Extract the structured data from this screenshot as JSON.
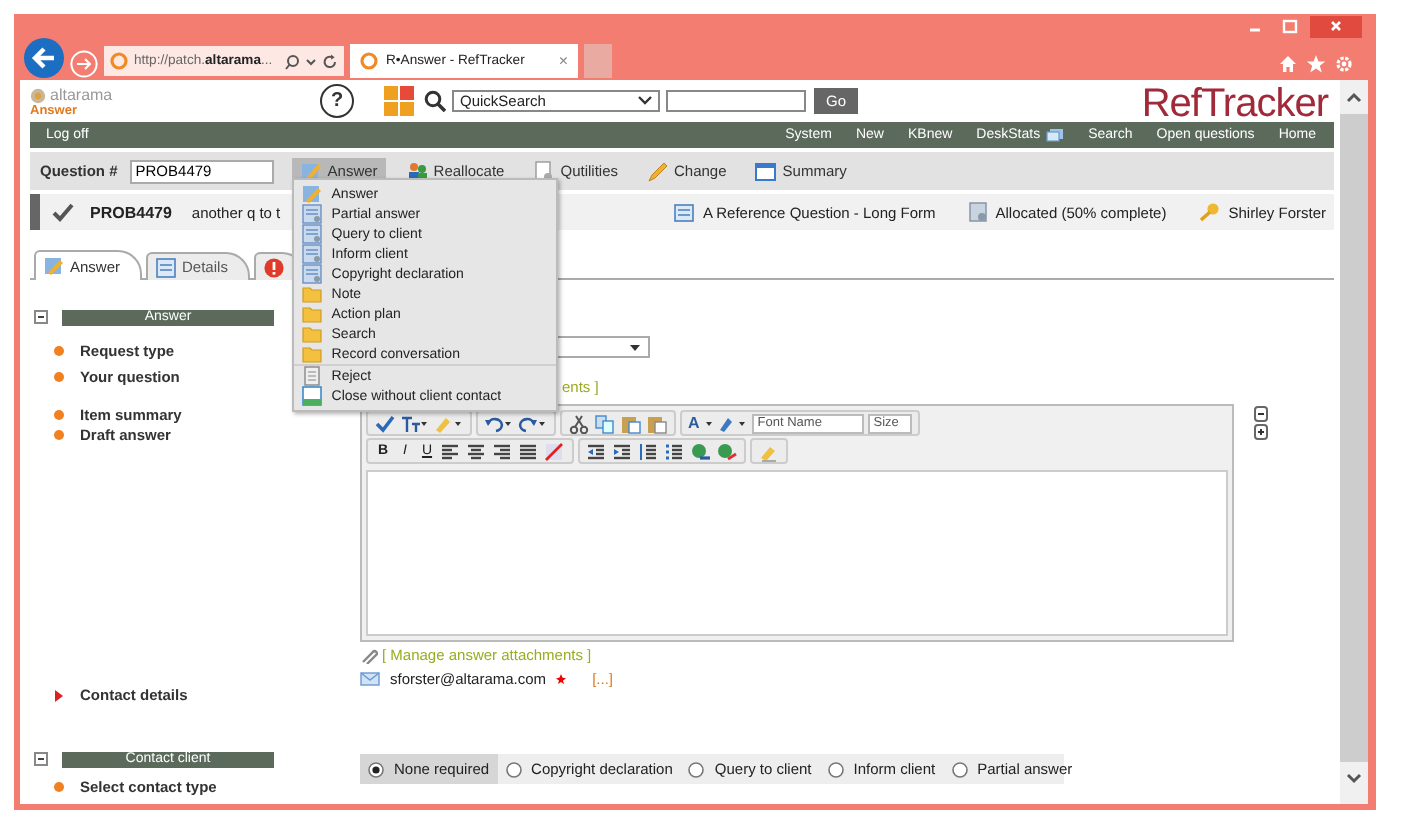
{
  "browser": {
    "address": "http://patch.**altarama**...",
    "tab_title": "R•Answer - RefTracker",
    "tab_close": "×"
  },
  "header": {
    "logo": "altarama",
    "product": "Answer",
    "help": "?",
    "quicksearch": "QuickSearch",
    "go": "Go",
    "brand": "RefTracker"
  },
  "nav": {
    "left": [
      {
        "label": "Log off",
        "kind": "link"
      }
    ],
    "right": [
      {
        "label": "System",
        "kind": "link"
      },
      {
        "label": "New",
        "kind": "link"
      },
      {
        "label": "KBnew",
        "kind": "link"
      },
      {
        "label": "DeskStats",
        "kind": "popup"
      },
      {
        "label": "Search",
        "kind": "link"
      },
      {
        "label": "Open questions",
        "kind": "link"
      },
      {
        "label": "Home",
        "kind": "link"
      }
    ]
  },
  "toolbar": {
    "question_label": "Question #",
    "question_value": "PROB4479",
    "buttons": [
      {
        "label": "Answer",
        "kind": "answer",
        "selected": true
      },
      {
        "label": "Reallocate",
        "kind": "reallocate",
        "selected": false
      },
      {
        "label": "Qutilities",
        "kind": "utilities",
        "selected": false
      },
      {
        "label": "Change",
        "kind": "change",
        "selected": false
      },
      {
        "label": "Summary",
        "kind": "summary",
        "selected": false
      }
    ]
  },
  "menu": {
    "items": [
      {
        "label": "Answer",
        "kind": "edit"
      },
      {
        "label": "Partial answer",
        "kind": "form"
      },
      {
        "label": "Query to client",
        "kind": "form"
      },
      {
        "label": "Inform client",
        "kind": "form"
      },
      {
        "label": "Copyright declaration",
        "kind": "form"
      },
      {
        "label": "Note",
        "kind": "folder"
      },
      {
        "label": "Action plan",
        "kind": "folder"
      },
      {
        "label": "Search",
        "kind": "folder"
      },
      {
        "label": "Record conversation",
        "kind": "folder"
      },
      {
        "label": "Reject",
        "kind": "reject"
      },
      {
        "label": "Close without client contact",
        "kind": "close"
      }
    ]
  },
  "info": {
    "id": "PROB4479",
    "summary": "another q to t",
    "form": "A Reference Question - Long Form",
    "status": "Allocated (50% complete)",
    "owner": "Shirley Forster"
  },
  "tabs": [
    {
      "label": "Answer",
      "kind": "edit",
      "selected": true
    },
    {
      "label": "Details",
      "kind": "details",
      "selected": false
    },
    {
      "kind": "alert",
      "selected": false
    }
  ],
  "left_panel": [
    {
      "kind": "section",
      "title": "Answer",
      "expanded": true
    },
    {
      "kind": "field",
      "label": "Request type"
    },
    {
      "kind": "field",
      "label": "Your question"
    },
    {
      "kind": "field",
      "label": "Item summary"
    },
    {
      "kind": "field",
      "label": "Draft answer"
    },
    {
      "kind": "group",
      "label": "Contact details",
      "expanded": false
    },
    {
      "kind": "section",
      "title": "Contact client",
      "expanded": true
    },
    {
      "kind": "field",
      "label": "Select contact type"
    }
  ],
  "partial_link": "ents ]",
  "editor": {
    "format_buttons": [
      "B",
      "I",
      "U"
    ],
    "font_color": "A",
    "font_name": "Font Name",
    "size": "Size"
  },
  "attachments_link": "[ Manage answer attachments ]",
  "contact": {
    "email": "sforster@altarama.com",
    "required": true,
    "more": "[...]"
  },
  "contact_types": [
    {
      "label": "None required",
      "selected": true
    },
    {
      "label": "Copyright declaration",
      "selected": false
    },
    {
      "label": "Query to client",
      "selected": false
    },
    {
      "label": "Inform client",
      "selected": false
    },
    {
      "label": "Partial answer",
      "selected": false
    }
  ]
}
